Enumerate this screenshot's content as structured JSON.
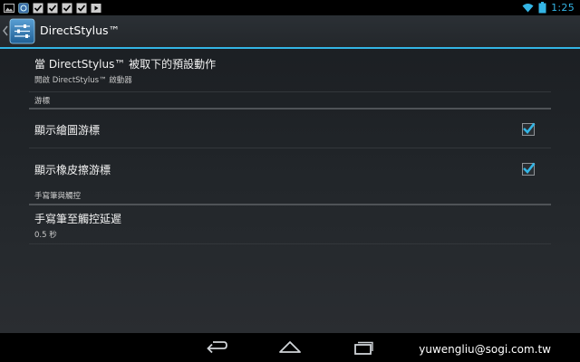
{
  "status_bar": {
    "time": "1:25",
    "notification_icons": [
      "image-icon",
      "app-icon",
      "checkbox-icon",
      "checkbox-icon",
      "checkbox-icon",
      "checkbox-icon",
      "play-icon"
    ],
    "accent": "#34b5e5"
  },
  "action_bar": {
    "title": "DirectStylus™",
    "accent": "#33b5e5"
  },
  "default_action": {
    "title": "當 DirectStylus™ 被取下的預設動作",
    "summary": "開啟 DirectStylus™ 啟動器"
  },
  "cursor_section": {
    "header": "游標",
    "items": [
      {
        "title": "顯示繪圖游標",
        "checked": true
      },
      {
        "title": "顯示橡皮擦游標",
        "checked": true
      }
    ]
  },
  "pen_section": {
    "header": "手寫筆與觸控",
    "delay": {
      "title": "手寫筆至觸控延遲",
      "summary": "0.5 秒"
    }
  },
  "nav": {
    "buttons": [
      "back-icon",
      "home-icon",
      "recent-apps-icon"
    ]
  },
  "watermark": "yuwengliu@sogi.com.tw"
}
